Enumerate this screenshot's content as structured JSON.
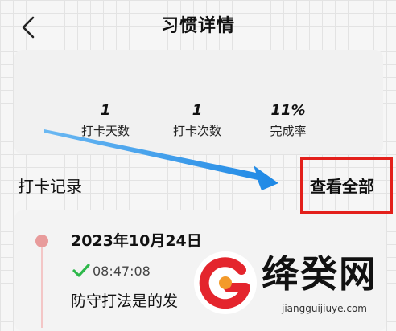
{
  "header": {
    "title": "习惯详情",
    "back_icon": "chevron-left-icon"
  },
  "stats": [
    {
      "value": "1",
      "label": "打卡天数"
    },
    {
      "value": "1",
      "label": "打卡次数"
    },
    {
      "value": "11%",
      "label": "完成率"
    }
  ],
  "records": {
    "title": "打卡记录",
    "view_all_label": "查看全部",
    "items": [
      {
        "date": "2023年10月24日",
        "time": "08:47:08",
        "note": "防守打法是的发",
        "status_icon": "check-icon"
      }
    ]
  },
  "watermark": {
    "name": "绛癸网",
    "url": "jiangguijiuye.com"
  },
  "colors": {
    "highlight_box": "#e3201b",
    "annotation_arrow": "#1e88e5",
    "check": "#2db84a",
    "timeline_dot": "#e89b9b"
  }
}
